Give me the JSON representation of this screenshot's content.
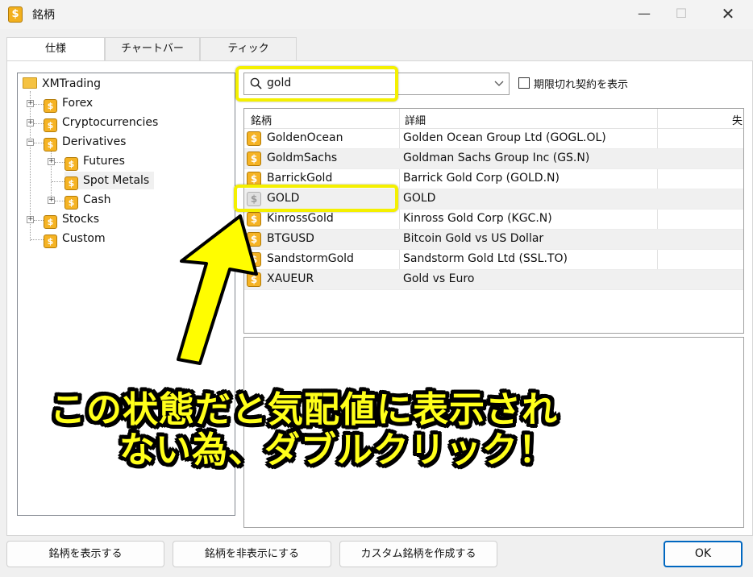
{
  "window": {
    "title": "銘柄",
    "minimize": "—",
    "maximize": "☐",
    "close": "✕"
  },
  "tabs": [
    {
      "label": "仕様"
    },
    {
      "label": "チャートバー"
    },
    {
      "label": "ティック"
    }
  ],
  "tree": {
    "root": "XMTrading",
    "items": [
      {
        "label": "Forex"
      },
      {
        "label": "Cryptocurrencies"
      },
      {
        "label": "Derivatives"
      },
      {
        "label": "Futures"
      },
      {
        "label": "Spot Metals"
      },
      {
        "label": "Cash"
      },
      {
        "label": "Stocks"
      },
      {
        "label": "Custom"
      }
    ]
  },
  "search": {
    "value": "gold"
  },
  "expired_checkbox": {
    "label": "期限切れ契約を表示",
    "checked": false
  },
  "table": {
    "columns": [
      "銘柄",
      "詳細",
      "失"
    ],
    "rows": [
      {
        "symbol": "GoldenOcean",
        "detail": "Golden Ocean Group Ltd (GOGL.OL)",
        "active": true
      },
      {
        "symbol": "GoldmSachs",
        "detail": "Goldman Sachs Group Inc (GS.N)",
        "active": true
      },
      {
        "symbol": "BarrickGold",
        "detail": "Barrick Gold Corp (GOLD.N)",
        "active": true
      },
      {
        "symbol": "GOLD",
        "detail": "GOLD",
        "active": false
      },
      {
        "symbol": "KinrossGold",
        "detail": "Kinross Gold Corp (KGC.N)",
        "active": true
      },
      {
        "symbol": "BTGUSD",
        "detail": "Bitcoin Gold vs US Dollar",
        "active": true
      },
      {
        "symbol": "SandstormGold",
        "detail": "Sandstorm Gold Ltd (SSL.TO)",
        "active": true
      },
      {
        "symbol": "XAUEUR",
        "detail": "Gold vs Euro",
        "active": true
      }
    ]
  },
  "icons": {
    "symbol": "$"
  },
  "buttons": {
    "show": "銘柄を表示する",
    "hide": "銘柄を非表示にする",
    "create_custom": "カスタム銘柄を作成する",
    "ok": "OK"
  },
  "annotation": {
    "line1": "この状態だと気配値に表示され",
    "line2": "ない為、ダブルクリック！"
  },
  "colors": {
    "highlight": "#f4f000",
    "accent": "#0067c0",
    "symbol_icon": "#f5b324"
  }
}
